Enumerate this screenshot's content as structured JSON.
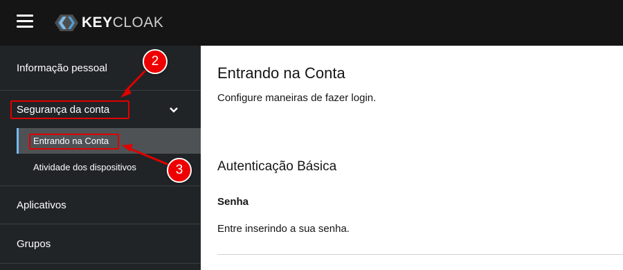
{
  "header": {
    "logo_text_bold": "KEY",
    "logo_text_thin": "CLOAK"
  },
  "sidebar": {
    "items": [
      {
        "label": "Informação pessoal"
      },
      {
        "label": "Segurança da conta",
        "expanded": true
      },
      {
        "label": "Aplicativos"
      },
      {
        "label": "Grupos"
      }
    ],
    "subitems": [
      {
        "label": "Entrando na Conta",
        "active": true
      },
      {
        "label": "Atividade dos dispositivos"
      }
    ]
  },
  "main": {
    "title": "Entrando na Conta",
    "subtitle": "Configure maneiras de fazer login.",
    "section_title": "Autenticação Básica",
    "password_title": "Senha",
    "password_desc": "Entre inserindo a sua senha."
  },
  "annotations": {
    "badge_2": "2",
    "badge_3": "3"
  },
  "colors": {
    "header_bg": "#151515",
    "sidebar_bg": "#212427",
    "active_item_bg": "#4f5255",
    "active_border": "#73bcf7",
    "annotation_red": "#e00000",
    "logo_icon_blue": "#4d9fd6"
  }
}
